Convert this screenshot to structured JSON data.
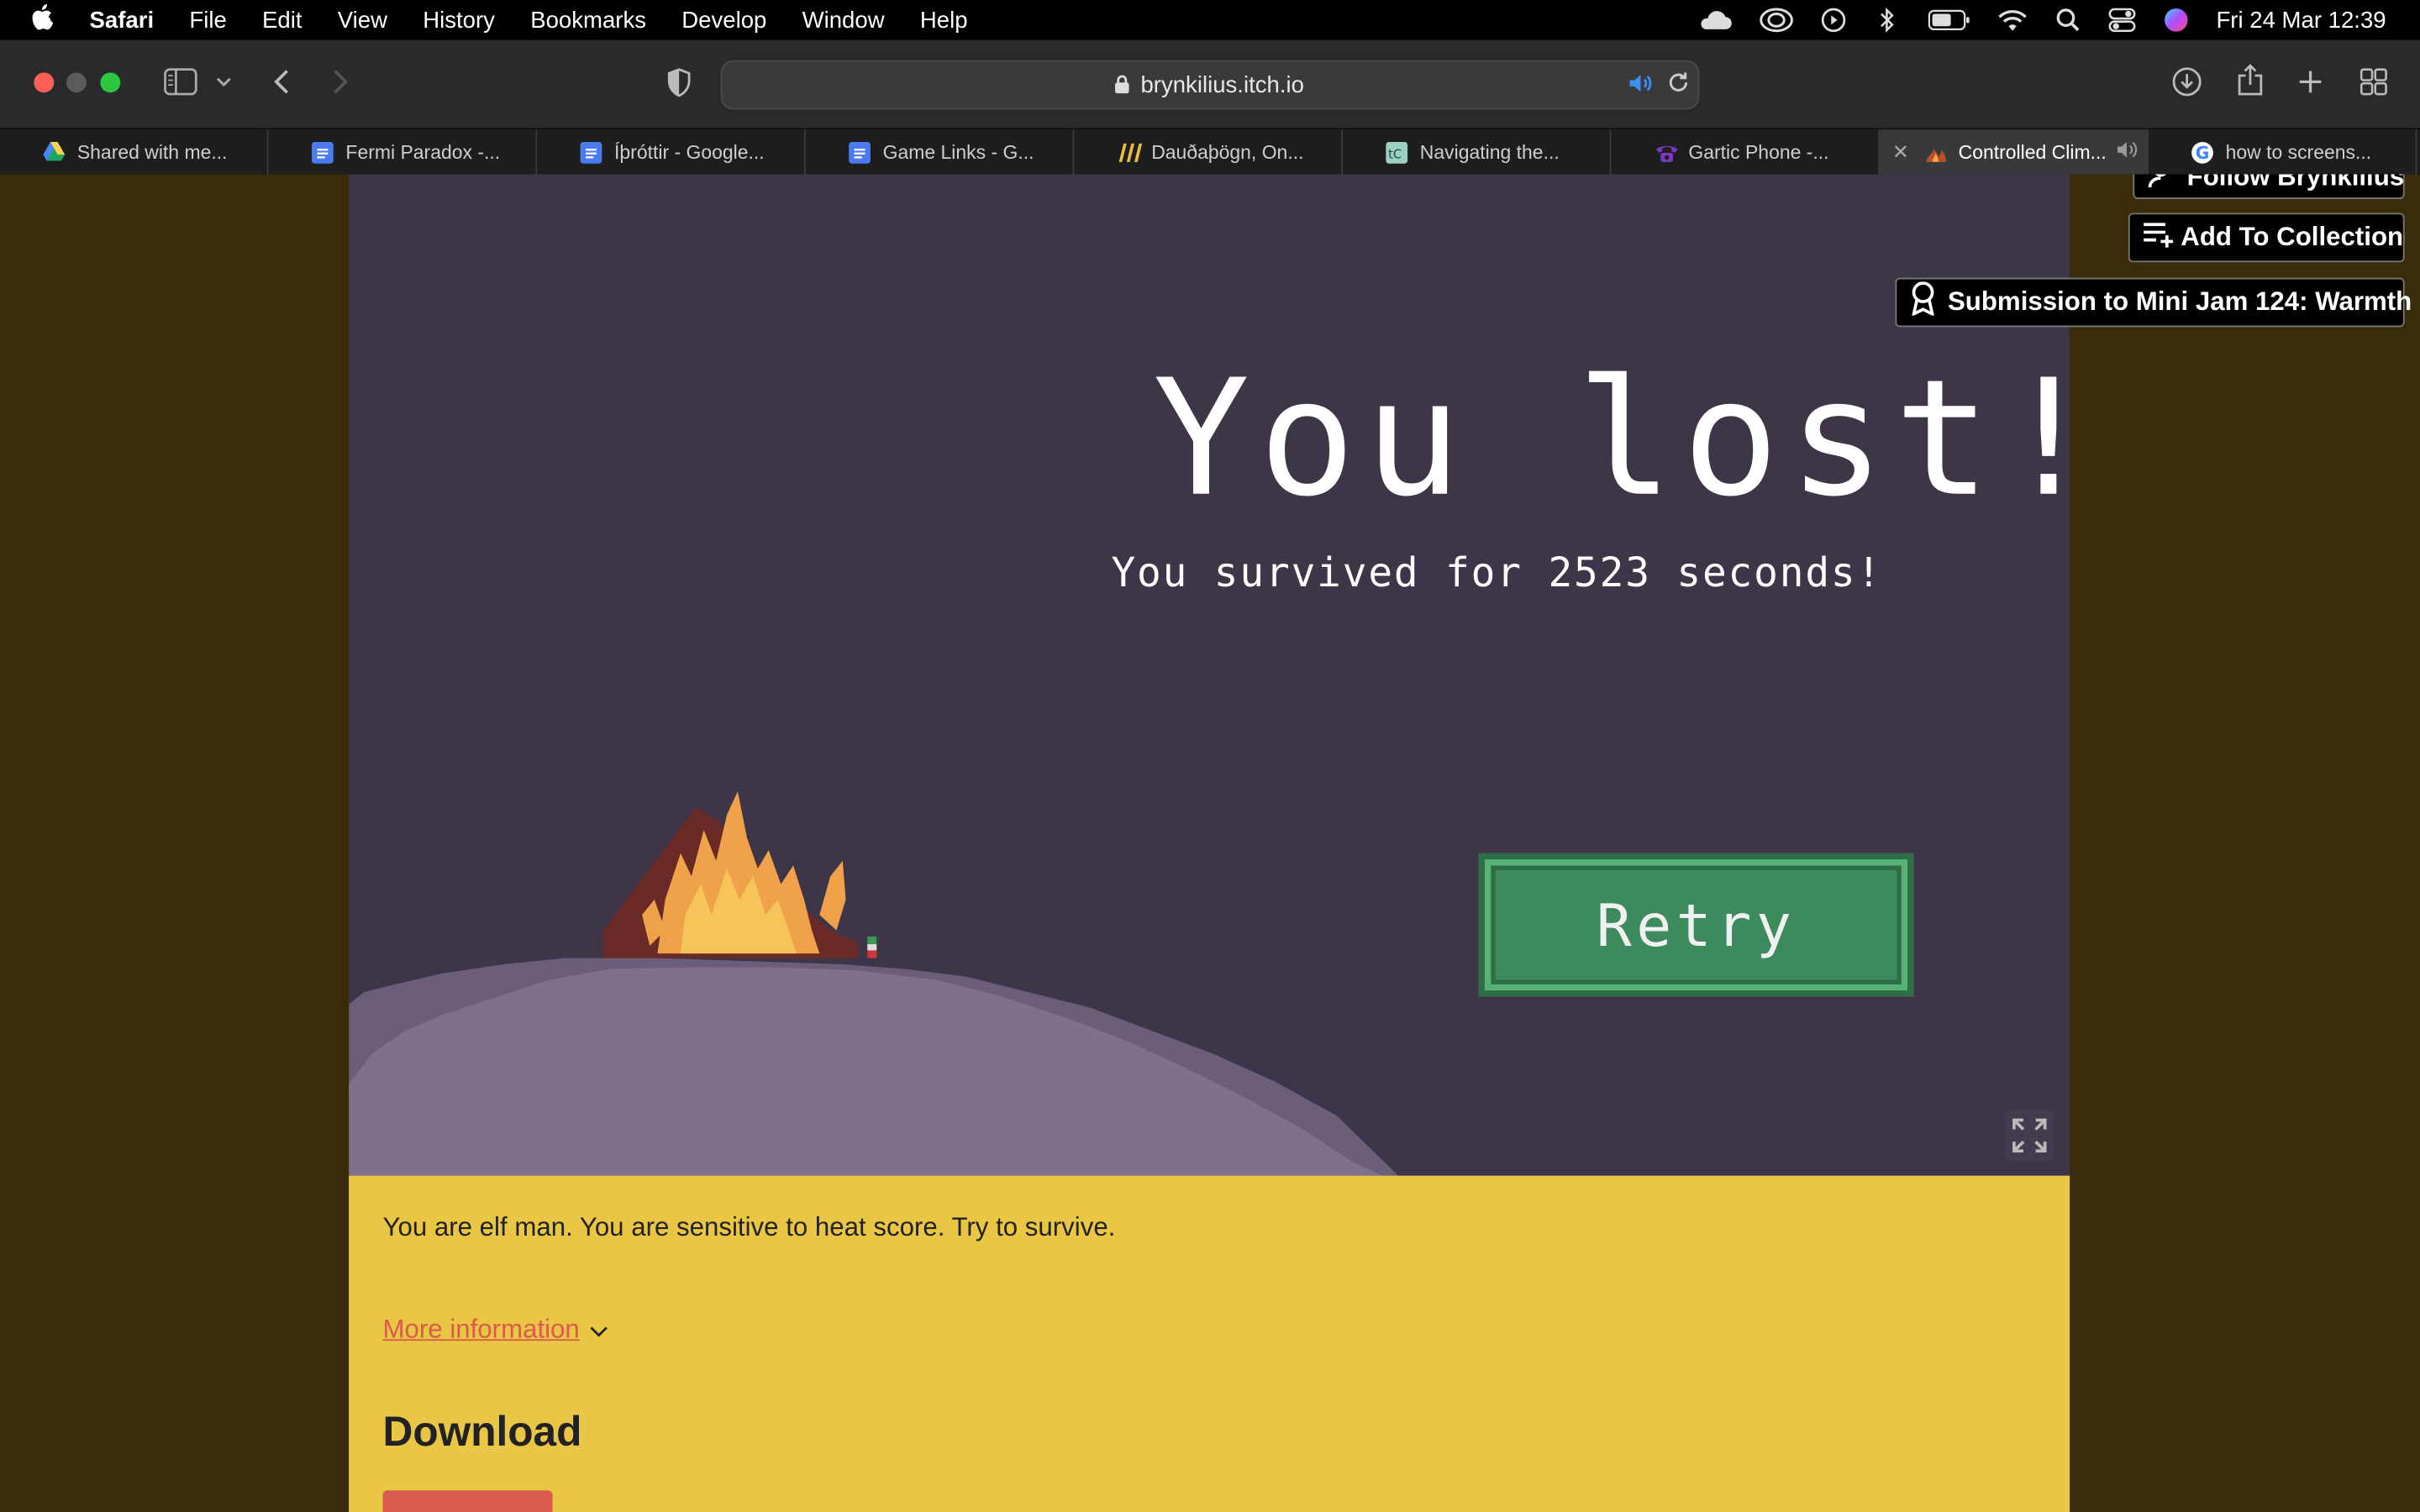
{
  "menubar": {
    "app_name": "Safari",
    "items": [
      "File",
      "Edit",
      "View",
      "History",
      "Bookmarks",
      "Develop",
      "Window",
      "Help"
    ],
    "clock": "Fri 24 Mar  12:39"
  },
  "browser": {
    "address": "brynkilius.itch.io",
    "tabs": [
      {
        "label": "Shared with me...",
        "favicon_color": "#1fa463",
        "icon": "google-drive-icon"
      },
      {
        "label": "Fermi Paradox -...",
        "favicon_color": "#4a7cf0",
        "icon": "google-docs-icon"
      },
      {
        "label": "Íþróttir - Google...",
        "favicon_color": "#4a7cf0",
        "icon": "google-docs-icon"
      },
      {
        "label": "Game Links - G...",
        "favicon_color": "#4a7cf0",
        "icon": "google-docs-icon"
      },
      {
        "label": "Dauðaþögn, On...",
        "favicon_color": "#e8c13a",
        "icon": "stripes-icon"
      },
      {
        "label": "Navigating the...",
        "favicon_color": "#9ad1c4",
        "icon": "tc-icon"
      },
      {
        "label": "Gartic Phone -...",
        "favicon_color": "#7a3ac0",
        "icon": "phone-icon"
      },
      {
        "label": "Controlled Clim...",
        "favicon_color": "#b4502a",
        "icon": "fire-icon",
        "active": true
      },
      {
        "label": "how to screens...",
        "favicon_color": "#ffffff",
        "icon": "google-icon"
      }
    ]
  },
  "page": {
    "follow_label": "Follow Brynkilius",
    "collection_label": "Add To Collection",
    "submission_label": "Submission to Mini Jam 124: Warmth",
    "game": {
      "title": "You lost!",
      "survived": "You survived for 2523 seconds!",
      "retry": "Retry"
    },
    "description": "You are elf man. You are sensitive to heat score. Try to survive.",
    "more_info": "More information",
    "download_heading": "Download"
  }
}
